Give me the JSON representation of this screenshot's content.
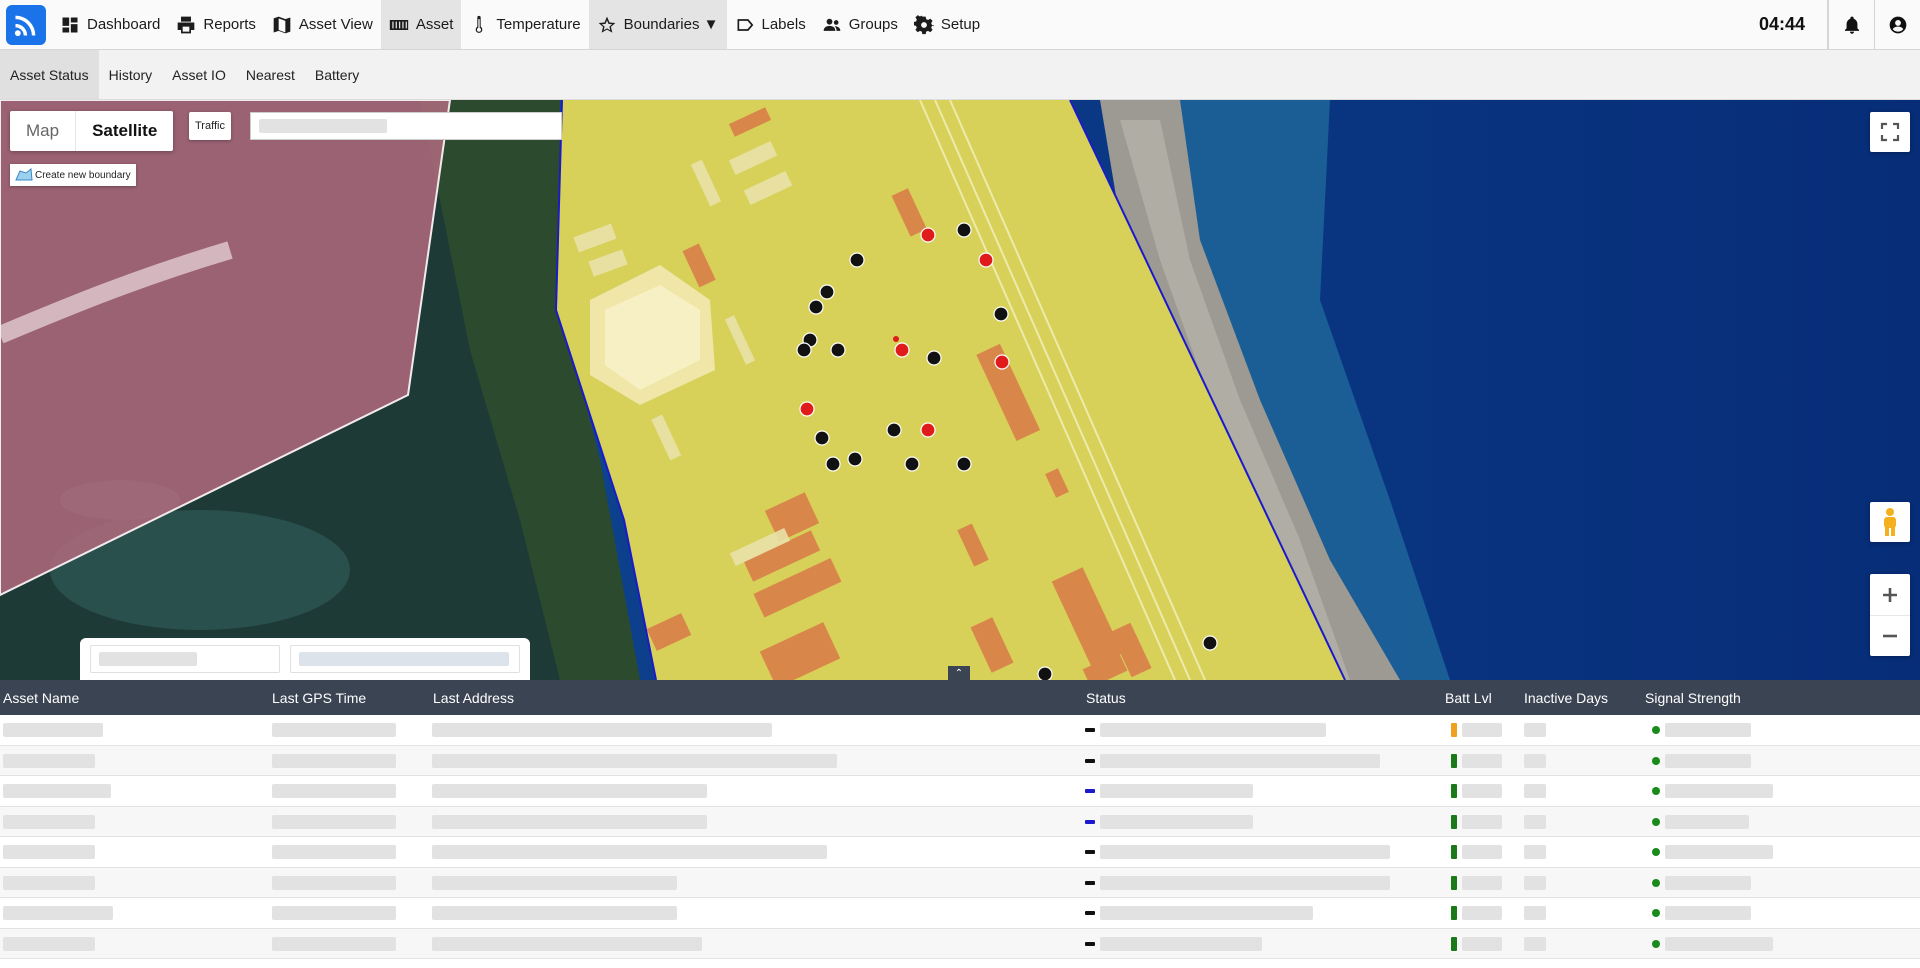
{
  "nav": {
    "logo_icon": "rss-signal-icon",
    "items": [
      {
        "label": "Dashboard",
        "icon": "dashboard-icon"
      },
      {
        "label": "Reports",
        "icon": "printer-icon"
      },
      {
        "label": "Asset View",
        "icon": "map-icon"
      },
      {
        "label": "Asset",
        "icon": "container-icon",
        "active": true
      },
      {
        "label": "Temperature",
        "icon": "thermometer-icon"
      },
      {
        "label": "Boundaries ▼",
        "icon": "star-icon",
        "active": true
      },
      {
        "label": "Labels",
        "icon": "label-icon"
      },
      {
        "label": "Groups",
        "icon": "groups-icon"
      },
      {
        "label": "Setup",
        "icon": "gear-icon"
      }
    ],
    "clock": "04:44"
  },
  "subtabs": [
    {
      "label": "Asset Status",
      "active": true
    },
    {
      "label": "History"
    },
    {
      "label": "Asset IO"
    },
    {
      "label": "Nearest"
    },
    {
      "label": "Battery"
    }
  ],
  "map": {
    "type_map": "Map",
    "type_satellite": "Satellite",
    "selected_type": "Satellite",
    "traffic": "Traffic",
    "create_boundary": "Create new boundary",
    "collapse_symbol": "⌃",
    "colors": {
      "boundary_fill": "#e8e25a",
      "boundary_line": "#1a1acc",
      "pink_zone": "#b06a7e",
      "asset_red": "#e01b1b",
      "asset_black": "#111111"
    }
  },
  "table": {
    "columns": [
      "Asset Name",
      "Last GPS Time",
      "Last Address",
      "Status",
      "Batt Lvl",
      "Inactive Days",
      "Signal Strength"
    ],
    "row_count": 8,
    "status_colors": [
      "#111111",
      "#111111",
      "#1a1acc",
      "#1a1acc",
      "#111111",
      "#111111",
      "#111111",
      "#111111"
    ],
    "battery_colors": [
      "#f0a020",
      "#1a7a1a",
      "#1a7a1a",
      "#1a7a1a",
      "#1a7a1a",
      "#1a7a1a",
      "#1a7a1a",
      "#1a7a1a"
    ],
    "signal_color": "#1a8a1a"
  }
}
